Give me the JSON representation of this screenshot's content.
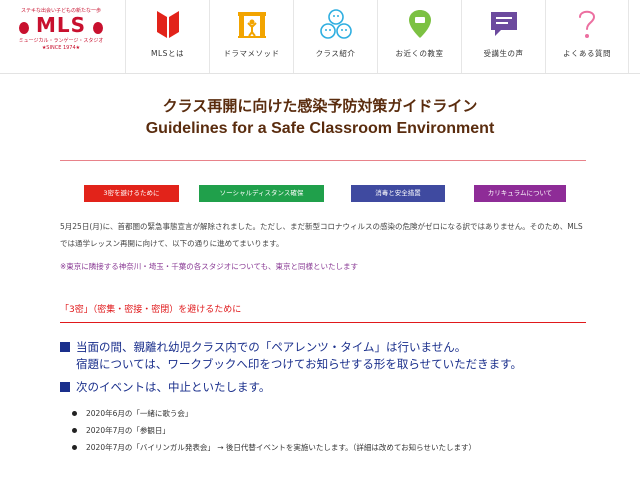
{
  "logo": {
    "tagline": "ステキな出会い子どもの新たな一歩",
    "name": "MLS",
    "subtitle": "ミュージカル・ランゲージ・スタジオ",
    "since": "★SINCE 1974★"
  },
  "nav": [
    {
      "label": "MLSとは",
      "icon": "book-icon"
    },
    {
      "label": "ドラマメソッド",
      "icon": "stage-icon"
    },
    {
      "label": "クラス紹介",
      "icon": "faces-icon"
    },
    {
      "label": "お近くの教室",
      "icon": "map-pin-icon"
    },
    {
      "label": "受講生の声",
      "icon": "speech-bubble-icon"
    },
    {
      "label": "よくある質問",
      "icon": "question-icon"
    }
  ],
  "title": {
    "jp": "クラス再開に向けた感染予防対策ガイドライン",
    "en": "Guidelines for a Safe Classroom Environment"
  },
  "buttons": [
    {
      "label": "3密を避けるために",
      "color": "#e2231a"
    },
    {
      "label": "ソーシャルディスタンス確保",
      "color": "#20a04b"
    },
    {
      "label": "消毒と安全措置",
      "color": "#3f4aa0"
    },
    {
      "label": "カリキュラムについて",
      "color": "#8e2c97"
    }
  ],
  "intro": "5月25日(月)に、首都圏の緊急事態宣言が解除されました。ただし、まだ新型コロナウィルスの感染の危険がゼロになる訳ではありません。そのため、MLSでは通学レッスン再開に向けて、以下の通りに進めてまいります。",
  "note": "※東京に隣接する神奈川・埼玉・千葉の各スタジオについても、東京と同様といたします",
  "section": {
    "title": "「3密」（密集・密接・密閉）を避けるために",
    "bullet1_line1": "当面の間、親離れ幼児クラス内での「ペアレンツ・タイム」は行いません。",
    "bullet1_line2": "宿題については、ワークブックへ印をつけてお知らせする形を取らせていただきます。",
    "bullet2": "次のイベントは、中止といたします。",
    "events": [
      "2020年6月の「一緒に歌う会」",
      "2020年7月の「参観日」",
      "2020年7月の「バイリンガル発表会」 → 後日代替イベントを実施いたします。（詳細は改めてお知らせいたします）"
    ]
  }
}
